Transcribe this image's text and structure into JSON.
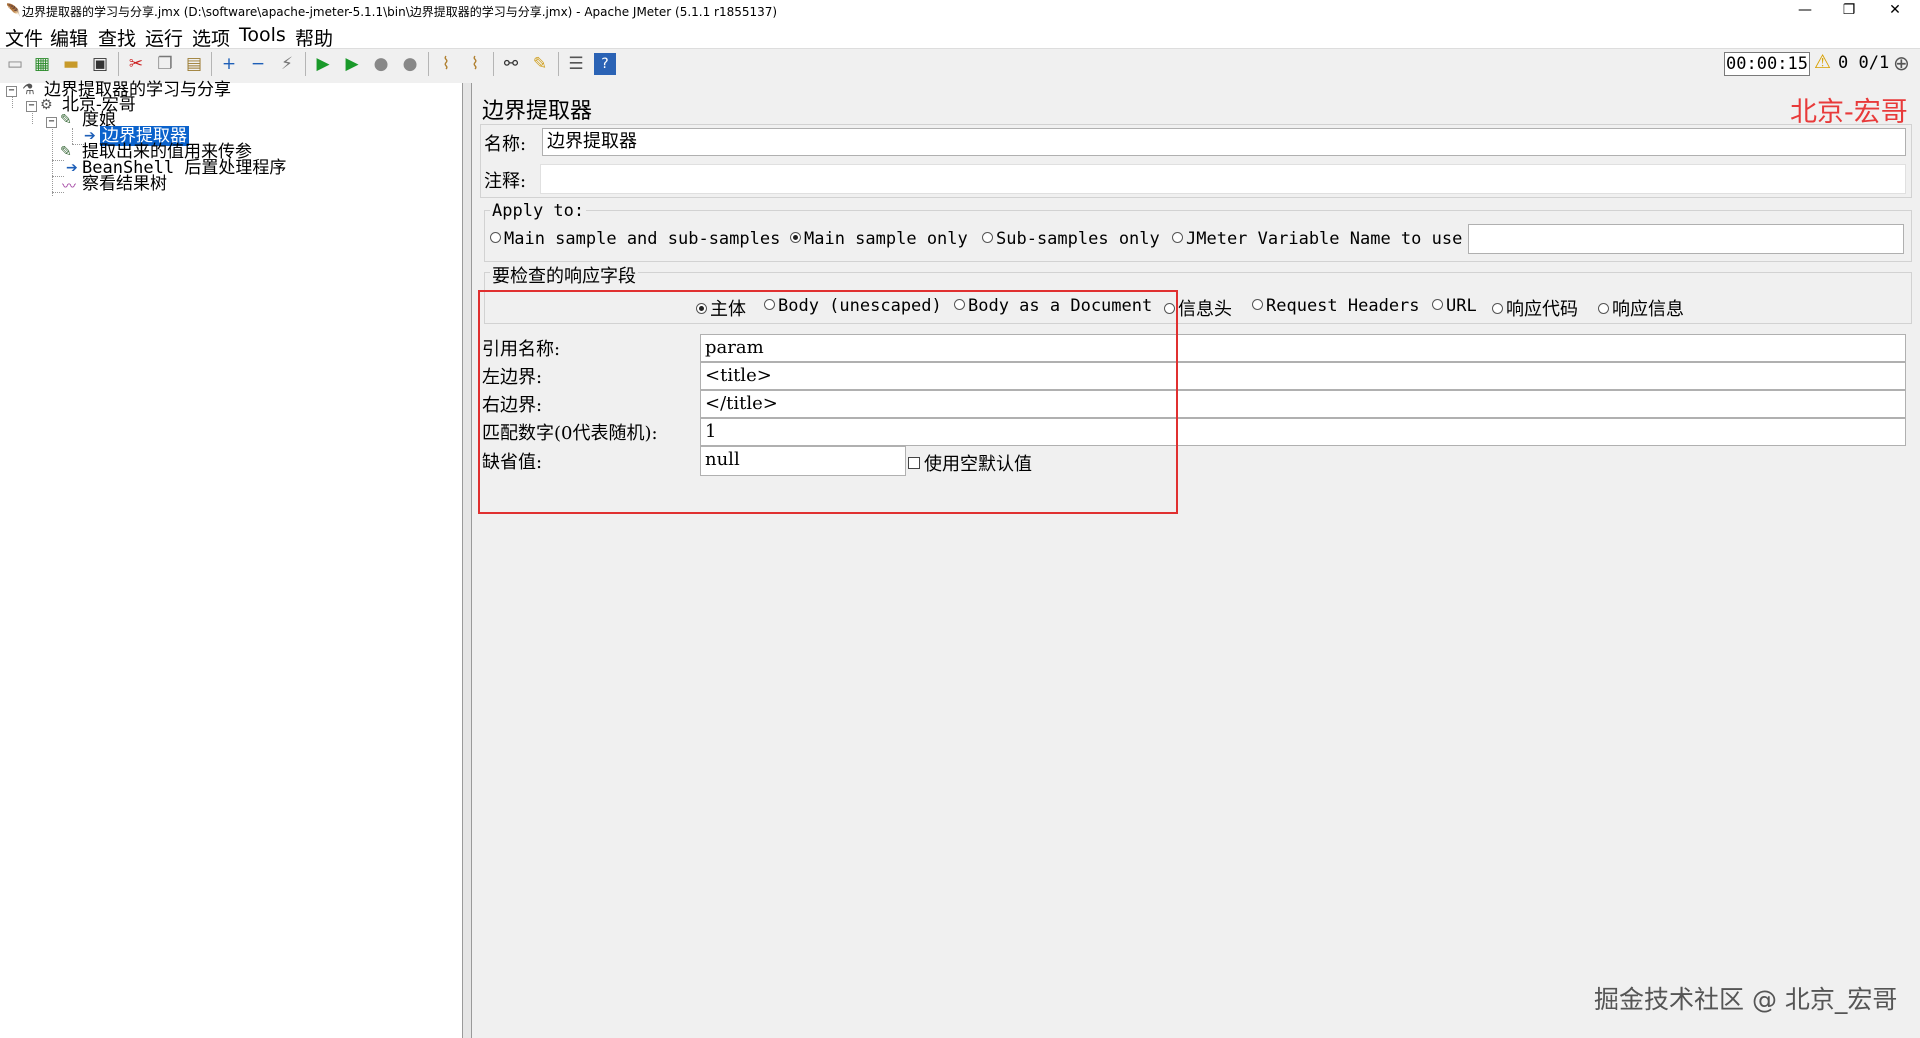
{
  "window": {
    "title": "边界提取器的学习与分享.jmx (D:\\software\\apache-jmeter-5.1.1\\bin\\边界提取器的学习与分享.jmx) - Apache JMeter (5.1.1 r1855137)",
    "minimize_label": "—",
    "restore_label": "❐",
    "close_label": "✕"
  },
  "menu": [
    "文件",
    "编辑",
    "查找",
    "运行",
    "选项",
    "Tools",
    "帮助"
  ],
  "toolbar": {
    "icons": [
      "new-icon",
      "templates-icon",
      "open-icon",
      "save-icon",
      "cut-icon",
      "copy-icon",
      "paste-icon",
      "expand-icon",
      "collapse-icon",
      "toggle-icon",
      "start-icon",
      "start-no-pause-icon",
      "stop-icon",
      "shutdown-icon",
      "clear-icon",
      "clear-all-icon",
      "search-icon",
      "reset-search-icon",
      "function-helper-icon",
      "help-icon"
    ],
    "timer": "00:00:15",
    "counts": "0  0/1"
  },
  "tree": {
    "root": "边界提取器的学习与分享",
    "thread_group": "北京-宏哥",
    "sampler": "度娘",
    "selected": "边界提取器",
    "child_1": "提取出来的值用来传参",
    "child_2": "BeanShell 后置处理程序",
    "child_3": "察看结果树"
  },
  "panel": {
    "title": "边界提取器",
    "brand": "北京-宏哥",
    "name_label": "名称:",
    "name_value": "边界提取器",
    "comment_label": "注释:",
    "comment_value": "",
    "apply_to": {
      "label": "Apply to:",
      "options": [
        "Main sample and sub-samples",
        "Main sample only",
        "Sub-samples only",
        "JMeter Variable Name to use"
      ],
      "selected": 1,
      "variable_name": ""
    },
    "field_group": {
      "label": "要检查的响应字段",
      "options": [
        "主体",
        "Body (unescaped)",
        "Body as a Document",
        "信息头",
        "Request Headers",
        "URL",
        "响应代码",
        "响应信息"
      ],
      "selected": 0
    },
    "ref_name_label": "引用名称:",
    "ref_name_value": "param",
    "left_boundary_label": "左边界:",
    "left_boundary_value": "<title>",
    "right_boundary_label": "右边界:",
    "right_boundary_value": "</title>",
    "match_no_label": "匹配数字(0代表随机):",
    "match_no_value": "1",
    "default_label": "缺省值:",
    "default_value": "null",
    "use_empty_default_label": "使用空默认值",
    "use_empty_default_checked": false
  },
  "watermark": "掘金技术社区 @ 北京_宏哥",
  "colors": {
    "highlight": "#e03030",
    "selection": "#0a62cc",
    "brand": "#e83a3a"
  }
}
